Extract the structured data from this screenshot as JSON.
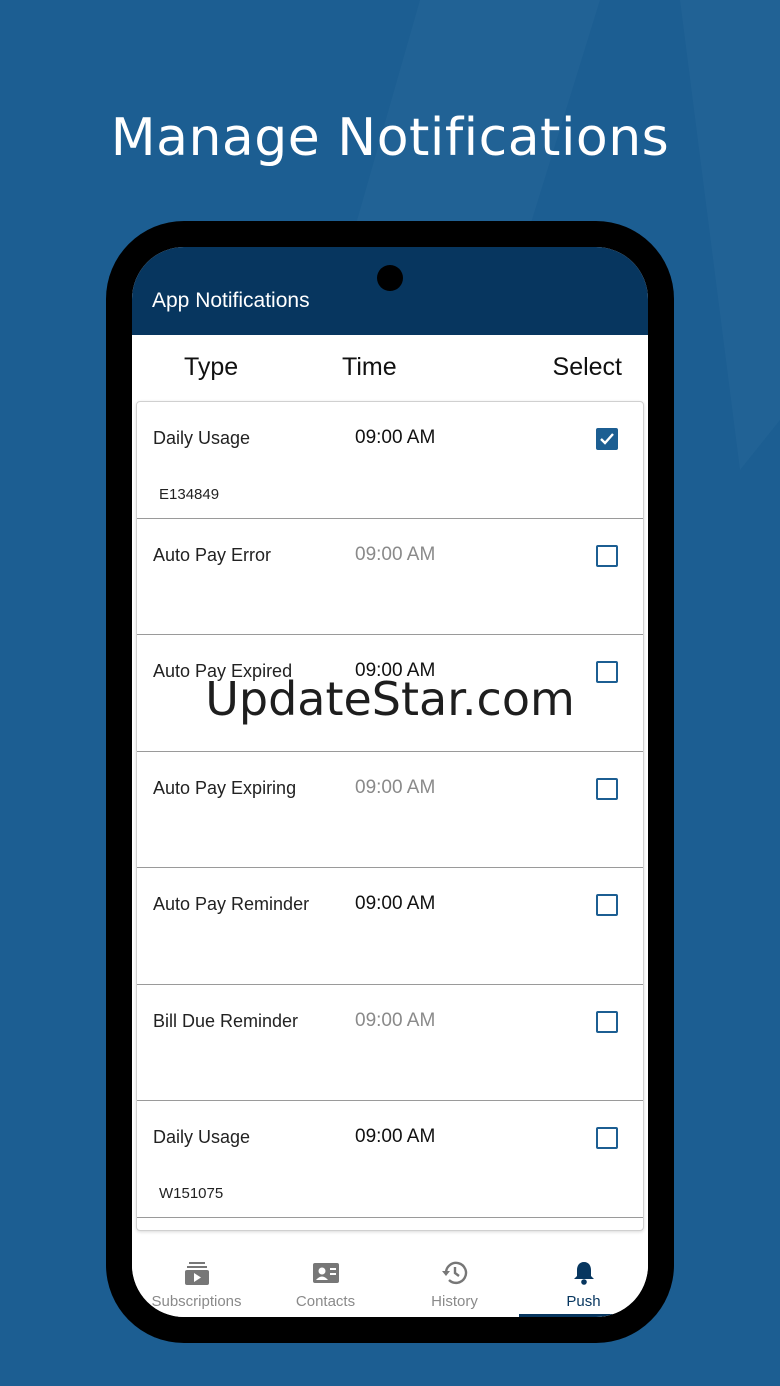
{
  "headline": "Manage Notifications",
  "appbar": {
    "title": "App Notifications"
  },
  "columns": {
    "type": "Type",
    "time": "Time",
    "select": "Select"
  },
  "rows": [
    {
      "type": "Daily Usage",
      "time": "09:00 AM",
      "time_muted": false,
      "sub": "E134849",
      "selected": true
    },
    {
      "type": "Auto Pay Error",
      "time": "09:00 AM",
      "time_muted": true,
      "sub": "",
      "selected": false
    },
    {
      "type": "Auto Pay Expired",
      "time": "09:00 AM",
      "time_muted": false,
      "sub": "",
      "selected": false
    },
    {
      "type": "Auto Pay Expiring",
      "time": "09:00 AM",
      "time_muted": true,
      "sub": "",
      "selected": false
    },
    {
      "type": "Auto Pay Reminder",
      "time": "09:00 AM",
      "time_muted": false,
      "sub": "",
      "selected": false
    },
    {
      "type": "Bill Due Reminder",
      "time": "09:00 AM",
      "time_muted": true,
      "sub": "",
      "selected": false
    },
    {
      "type": "Daily Usage",
      "time": "09:00 AM",
      "time_muted": false,
      "sub": "W151075",
      "selected": false
    }
  ],
  "nav": [
    {
      "label": "Subscriptions",
      "icon": "subscriptions-icon",
      "active": false
    },
    {
      "label": "Contacts",
      "icon": "contacts-icon",
      "active": false
    },
    {
      "label": "History",
      "icon": "history-icon",
      "active": false
    },
    {
      "label": "Push",
      "icon": "bell-icon",
      "active": true
    }
  ],
  "watermark": "UpdateStar.com",
  "colors": {
    "background": "#1c5e92",
    "appbar": "#07365f",
    "accent": "#1c5e92"
  }
}
